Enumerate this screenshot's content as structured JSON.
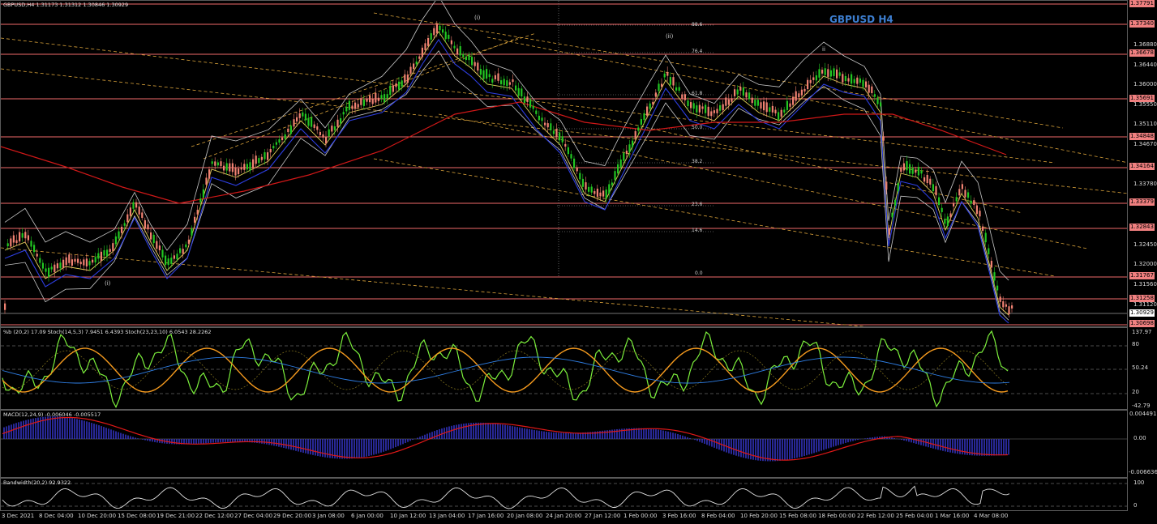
{
  "main": {
    "header": "GBPUSD,H4  1.31173 1.31312 1.30846 1.30929",
    "title": "GBPUSD H4",
    "price_axis": [
      "1.36880",
      "1.36440",
      "1.36000",
      "1.35550",
      "1.35110",
      "1.34670",
      "1.33780",
      "1.32450",
      "1.32000",
      "1.31560",
      "1.31120"
    ],
    "price_tags": [
      {
        "text": "1.37791",
        "bg": "#f08080",
        "fg": "#000000"
      },
      {
        "text": "1.37340",
        "bg": "#f08080",
        "fg": "#000000"
      },
      {
        "text": "1.36678",
        "bg": "#f08080",
        "fg": "#000000"
      },
      {
        "text": "1.35691",
        "bg": "#f08080",
        "fg": "#000000"
      },
      {
        "text": "1.34848",
        "bg": "#f08080",
        "fg": "#000000"
      },
      {
        "text": "1.34164",
        "bg": "#f08080",
        "fg": "#000000"
      },
      {
        "text": "1.33379",
        "bg": "#f08080",
        "fg": "#000000"
      },
      {
        "text": "1.32843",
        "bg": "#f08080",
        "fg": "#000000"
      },
      {
        "text": "1.31767",
        "bg": "#f08080",
        "fg": "#000000"
      },
      {
        "text": "1.31258",
        "bg": "#f08080",
        "fg": "#000000"
      },
      {
        "text": "1.30929",
        "bg": "#ffffff",
        "fg": "#000000"
      },
      {
        "text": "1.30698",
        "bg": "#f08080",
        "fg": "#000000"
      }
    ],
    "fib_labels": [
      "88.6",
      "76.4",
      "61.8",
      "50.0",
      "38.2",
      "23.6",
      "14.6",
      "0.0"
    ],
    "wave_labels": [
      "(i)",
      "(ii)",
      "ii",
      "(i)"
    ]
  },
  "stoch": {
    "header": "%b (20,2) 17.09  Stoch(14,5,3) 7.9451 6.4393  Stoch(23,23,10) 6.0543 28.2262",
    "axis": [
      "137.97",
      "80",
      "50.24",
      "20",
      "-42.79"
    ]
  },
  "macd": {
    "header": "MACD(12,24,9) -0.006046 -0.005517",
    "axis": [
      "0.004491",
      "0.00",
      "-0.006636"
    ]
  },
  "bandwidth": {
    "header": "Bandwidth(20,2) 92.9322",
    "axis": [
      "100",
      "0"
    ]
  },
  "time_axis": [
    "3 Dec 2021",
    "8 Dec 04:00",
    "10 Dec 20:00",
    "15 Dec 08:00",
    "19 Dec 21:00",
    "22 Dec 12:00",
    "27 Dec 04:00",
    "29 Dec 20:00",
    "3 Jan 08:00",
    "6 Jan 00:00",
    "10 Jan 12:00",
    "13 Jan 04:00",
    "17 Jan 16:00",
    "20 Jan 08:00",
    "24 Jan 20:00",
    "27 Jan 12:00",
    "1 Feb 00:00",
    "3 Feb 16:00",
    "8 Feb 04:00",
    "10 Feb 20:00",
    "15 Feb 08:00",
    "18 Feb 00:00",
    "22 Feb 12:00",
    "25 Feb 04:00",
    "1 Mar 16:00",
    "4 Mar 08:00"
  ],
  "colors": {
    "bull": "#22c722",
    "bear": "#f08272",
    "ma_red": "#d01818",
    "ma_blue": "#2d3ee0",
    "ma_yellow": "#e2d15a",
    "band": "#c8c8c8",
    "level": "#f06a6a",
    "channel": "#d9a23a",
    "stoch_green": "#7cf03c",
    "stoch_orange": "#f59a1e",
    "stoch_blue": "#2f7fe6",
    "macd_hist": "#3a3ad6",
    "macd_signal": "#e01818"
  }
}
